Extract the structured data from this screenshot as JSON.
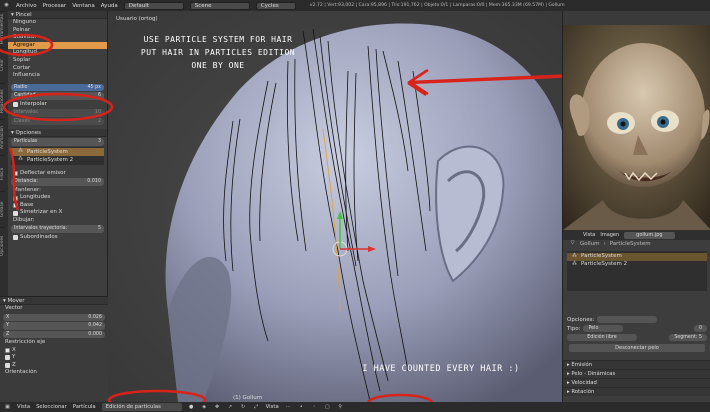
{
  "topbar": {
    "menu": [
      "Archivo",
      "Procesar",
      "Ventana",
      "Ayuda"
    ],
    "layout": "Default",
    "scene": "Scene",
    "engine": "Cycles",
    "stats": "v2.72 | Vert:93,002 | Cara:95,896 | Tris:191,762 | Objeto:0/1 | Lamparas:0/0 | Mem:365.33M (69.57M) | Gollum"
  },
  "lefttabs": [
    "Herramientas",
    "Crear",
    "Relaciones",
    "Animación",
    "Física",
    "Grease",
    "Opciones"
  ],
  "brush": {
    "header": "Pincel",
    "items": [
      "Ninguno",
      "Peinar",
      "Suavizar",
      "Agregar",
      "Longitud",
      "Soplar",
      "Cortar",
      "Influencia"
    ],
    "selected": "Agregar",
    "radius_label": "Radio",
    "radius_value": "45 px",
    "count_label": "Cantidad",
    "count_value": "6",
    "interp_label": "Interpolar",
    "steps_label": "Intervalos",
    "steps_value": "10",
    "keys_label": "Claves",
    "keys_value": "2"
  },
  "options": {
    "header": "Opciones",
    "mode_label": "Partículas",
    "mode_value": "3",
    "systems": [
      "ParticleSystem",
      "ParticleSystem 2"
    ],
    "deflect_label": "Deflectar emisor",
    "distance_label": "Distancia:",
    "distance_value": "0.010",
    "keep_label": "Mantener:",
    "lengths_label": "Longitudes",
    "base_label": "Base",
    "mirror_label": "Simetrizar en X",
    "draw_label": "Dibujar:",
    "steps_label": "Intervalos trayectoria:",
    "steps_value": "5",
    "children_label": "Subordinados"
  },
  "operator": {
    "header": "Mover",
    "vector_label": "Vector",
    "x_label": "X",
    "x_value": "0.026",
    "y_label": "Y",
    "y_value": "0.042",
    "z_label": "Z",
    "z_value": "0.000",
    "axis_label": "Restricción eje",
    "ax": [
      "X",
      "Y",
      "Z"
    ],
    "orient_label": "Orientación"
  },
  "viewport": {
    "label": "Usuario (ortog)",
    "bottom_label": "(1) Gollum"
  },
  "annotations": {
    "top": [
      "USE PARTICLE SYSTEM FOR HAIR",
      "PUT HAIR IN PARTICLES EDITION",
      "ONE BY ONE"
    ],
    "bottom": "I HAVE COUNTED EVERY HAIR :)"
  },
  "imageeditor": {
    "tabs": [
      "Vista",
      "Imagen"
    ],
    "filename": "gollum.jpg"
  },
  "properties": {
    "breadcrumb": "Gollum",
    "breadcrumb_2": "ParticleSystem",
    "systems": [
      "ParticleSystem",
      "ParticleSystem 2"
    ],
    "opciones_label": "Opciones:",
    "tipo_label": "Tipo:",
    "tipo_value": "Pelo",
    "seed_value": "0",
    "edit_button": "Edición libre",
    "segments_label": "Segment:",
    "segments_value": "5",
    "disconnect_button": "Desconectar pelo",
    "sections": [
      "Emisión",
      "Pelo - Dinámicas",
      "Velocidad",
      "Rotación"
    ]
  },
  "bottombar": {
    "items": [
      "Vista",
      "Seleccionar",
      "Partícula"
    ],
    "mode": "Edición de partículas",
    "view_label": "Vista"
  },
  "colors": {
    "annotation_red": "#d8231a",
    "selected_orange": "#e09a4a",
    "gizmo_green": "#3ec43e",
    "gizmo_red": "#e03030"
  }
}
